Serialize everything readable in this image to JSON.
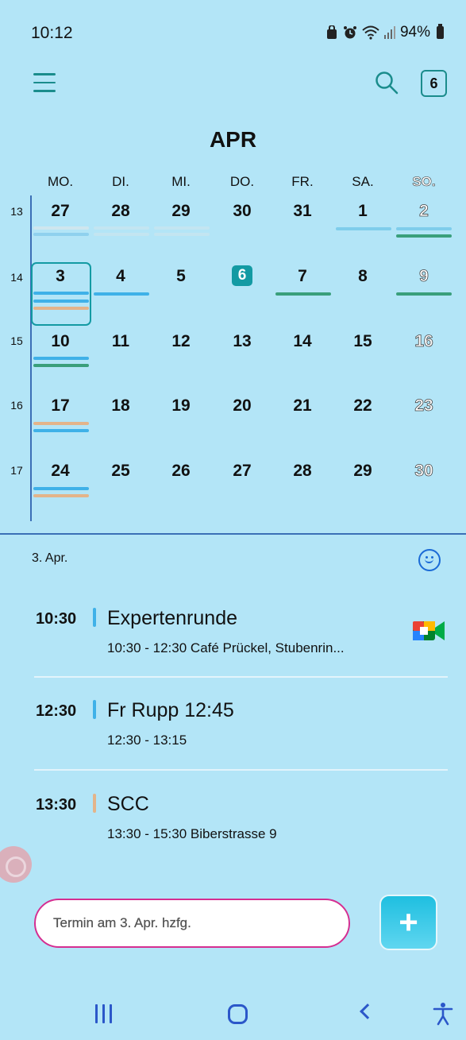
{
  "status": {
    "time": "10:12",
    "battery": "94%"
  },
  "header": {
    "month": "APR",
    "today_badge": "6"
  },
  "weekdays": [
    "MO.",
    "DI.",
    "MI.",
    "DO.",
    "FR.",
    "SA.",
    "SO."
  ],
  "weeks": [
    {
      "num": "13",
      "days": [
        "27",
        "28",
        "29",
        "30",
        "31",
        "1",
        "2"
      ]
    },
    {
      "num": "14",
      "days": [
        "3",
        "4",
        "5",
        "6",
        "7",
        "8",
        "9"
      ]
    },
    {
      "num": "15",
      "days": [
        "10",
        "11",
        "12",
        "13",
        "14",
        "15",
        "16"
      ]
    },
    {
      "num": "16",
      "days": [
        "17",
        "18",
        "19",
        "20",
        "21",
        "22",
        "23"
      ]
    },
    {
      "num": "17",
      "days": [
        "24",
        "25",
        "26",
        "27",
        "28",
        "29",
        "30"
      ]
    }
  ],
  "colors": {
    "blue": "#3fb1e8",
    "green": "#3a9f7b",
    "peach": "#e3b48a",
    "light_blue": "#7fcdeb",
    "faint": "#bfe2ef",
    "accent": "#139aa3"
  },
  "agenda": {
    "date_label": "3. Apr.",
    "events": [
      {
        "time": "10:30",
        "title": "Expertenrunde",
        "subtitle": "10:30 - 12:30  Café Prückel, Stubenrin...",
        "color": "#3fb1e8",
        "icon": "google-meet-icon"
      },
      {
        "time": "12:30",
        "title": "Fr Rupp 12:45",
        "subtitle": "12:30 - 13:15",
        "color": "#3fb1e8"
      },
      {
        "time": "13:30",
        "title": "SCC",
        "subtitle": "13:30 - 15:30  Biberstrasse 9",
        "color": "#e3b48a"
      }
    ]
  },
  "quick_add": {
    "placeholder": "Termin am 3. Apr. hzfg."
  }
}
